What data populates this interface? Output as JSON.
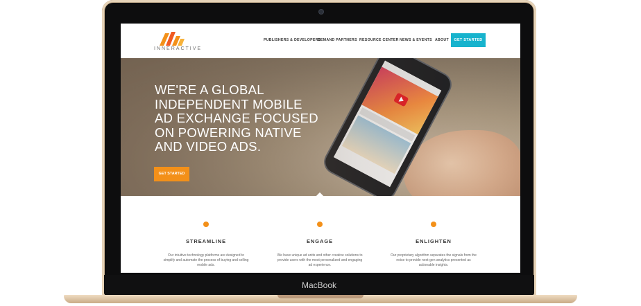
{
  "device": {
    "brand_label": "MacBook"
  },
  "site": {
    "logo_text": "INNERACTIVE",
    "nav": [
      "PUBLISHERS & DEVELOPERS",
      "DEMAND PARTNERS",
      "RESOURCE CENTER",
      "NEWS & EVENTS",
      "ABOUT"
    ],
    "nav_cta": "GET STARTED"
  },
  "hero": {
    "headline": "WE'RE A GLOBAL INDEPENDENT MOBILE AD EXCHANGE FOCUSED ON POWERING NATIVE AND VIDEO ADS.",
    "cta": "GET STARTED"
  },
  "features": [
    {
      "title": "STREAMLINE",
      "text": "Our intuitive technology platforms are designed to simplify and automate the process of buying and selling mobile ads."
    },
    {
      "title": "ENGAGE",
      "text": "We have unique ad units and other creative solutions to provide users with the most personalized and engaging ad experience."
    },
    {
      "title": "ENLIGHTEN",
      "text": "Our proprietary algorithm separates the signals from the noise to provide next-gen analytics presented as actionable insights."
    }
  ],
  "colors": {
    "accent_orange": "#f39019",
    "accent_teal": "#17b3cd"
  }
}
